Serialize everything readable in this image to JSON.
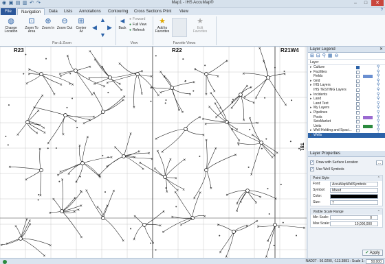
{
  "window": {
    "title": "Map1 - IHS AccuMap®"
  },
  "tabs": [
    "File",
    "Navigation",
    "Data",
    "Lists",
    "Annotations",
    "Contouring",
    "Cross Sections",
    "Print",
    "View"
  ],
  "active_tab": "Navigation",
  "ribbon": {
    "change_location": "Change Location",
    "zoom_to_area": "Zoom To Area",
    "zoom_in": "Zoom In",
    "zoom_out": "Zoom Out",
    "center_at": "Center At",
    "back": "Back",
    "forward": "Forward",
    "full_view": "Full View",
    "refresh": "Refresh",
    "add_to_favorites": "Add to Favorites",
    "edit_favorites": "Edit Favorites",
    "group_pan_zoom": "Pan & Zoom",
    "group_view": "View",
    "group_favorite_views": "Favorite Views"
  },
  "map": {
    "labels": {
      "r23": "R23",
      "r22": "R22",
      "r21w4": "R21W4",
      "t81": "T81"
    }
  },
  "legend": {
    "title": "Layer Legend",
    "column_header": "Layer",
    "layers": [
      {
        "name": "Culture",
        "expand": true,
        "on": true,
        "swatch": ""
      },
      {
        "name": "Facilities",
        "expand": true,
        "on": false,
        "swatch": ""
      },
      {
        "name": "Fields",
        "expand": false,
        "on": false,
        "swatch": "#6a8fd1"
      },
      {
        "name": "Grid",
        "expand": true,
        "on": false,
        "swatch": ""
      },
      {
        "name": "IHS Layers",
        "expand": true,
        "on": false,
        "swatch": ""
      },
      {
        "name": "IHS TESTING Layers",
        "expand": false,
        "on": false,
        "swatch": ""
      },
      {
        "name": "Incidents",
        "expand": true,
        "on": false,
        "swatch": ""
      },
      {
        "name": "Land",
        "expand": true,
        "on": false,
        "swatch": ""
      },
      {
        "name": "Land Text",
        "expand": false,
        "on": false,
        "swatch": ""
      },
      {
        "name": "My Layers",
        "expand": true,
        "on": false,
        "swatch": ""
      },
      {
        "name": "Pipelines",
        "expand": true,
        "on": false,
        "swatch": ""
      },
      {
        "name": "Pools",
        "expand": false,
        "on": false,
        "swatch": "#9a6ad1"
      },
      {
        "name": "SeisMarket",
        "expand": false,
        "on": false,
        "swatch": ""
      },
      {
        "name": "Units",
        "expand": false,
        "on": false,
        "swatch": "#2b8a3e"
      },
      {
        "name": "Well Holding and Spaci...",
        "expand": true,
        "on": false,
        "swatch": ""
      },
      {
        "name": "Wells",
        "expand": true,
        "on": true,
        "swatch": "",
        "selected": true
      }
    ]
  },
  "properties": {
    "title": "Layer Properties",
    "draw_surface": "Draw with Surface Location",
    "use_well_symbols": "Use Well Symbols",
    "point_style": {
      "title": "Point Style",
      "font_label": "Font:",
      "font_value": "AccuMapWellSymbols",
      "symbol_label": "Symbol:",
      "symbol_value": "Mixed",
      "color_label": "Color:",
      "size_label": "Size:",
      "size_value": "7"
    },
    "visible_scale": {
      "title": "Visible Scale Range",
      "min_label": "Min Scale:",
      "min_value": "0",
      "max_label": "Max Scale:",
      "max_value": "10,000,000"
    },
    "apply": "Apply"
  },
  "status": {
    "text": "NAD27 : 56.0290, -113.3881 : Scale 1:",
    "scale": "50,000"
  }
}
